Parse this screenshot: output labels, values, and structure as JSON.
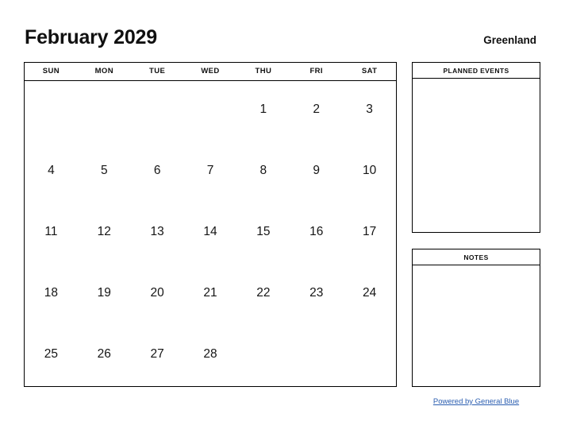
{
  "header": {
    "title": "February 2029",
    "location": "Greenland"
  },
  "calendar": {
    "month": "February",
    "year": "2029",
    "weekdays": [
      "SUN",
      "MON",
      "TUE",
      "WED",
      "THU",
      "FRI",
      "SAT"
    ],
    "weeks": [
      [
        "",
        "",
        "",
        "",
        "1",
        "2",
        "3"
      ],
      [
        "4",
        "5",
        "6",
        "7",
        "8",
        "9",
        "10"
      ],
      [
        "11",
        "12",
        "13",
        "14",
        "15",
        "16",
        "17"
      ],
      [
        "18",
        "19",
        "20",
        "21",
        "22",
        "23",
        "24"
      ],
      [
        "25",
        "26",
        "27",
        "28",
        "",
        "",
        ""
      ]
    ]
  },
  "panels": {
    "events": {
      "title": "PLANNED EVENTS",
      "content": ""
    },
    "notes": {
      "title": "NOTES",
      "content": ""
    }
  },
  "footer": {
    "link_text": "Powered by General Blue"
  },
  "colors": {
    "link": "#2a5db0",
    "border": "#000000",
    "text": "#101010",
    "background": "#ffffff"
  }
}
